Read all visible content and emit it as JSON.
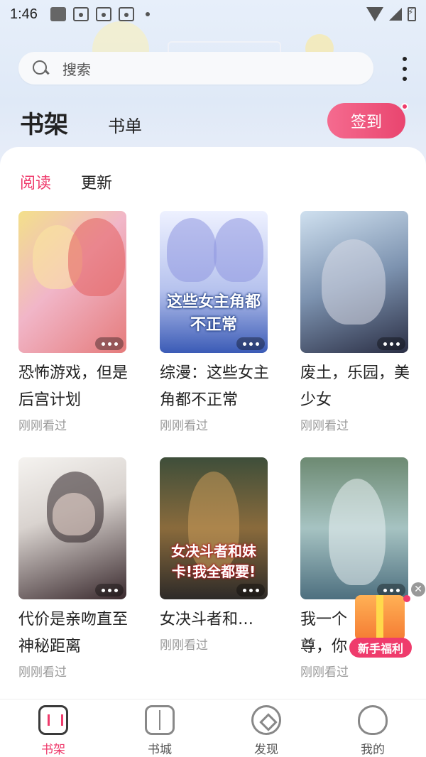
{
  "status_bar": {
    "time": "1:46"
  },
  "search": {
    "placeholder": "搜索"
  },
  "tabs": {
    "bookshelf": "书架",
    "booklist": "书单"
  },
  "checkin": {
    "label": "签到"
  },
  "subtabs": {
    "reading": "阅读",
    "updates": "更新"
  },
  "books": [
    {
      "title": "恐怖游戏，但是后宫计划",
      "status": "刚刚看过"
    },
    {
      "title": "综漫：这些女主角都不正常",
      "status": "刚刚看过",
      "cover_text": "这些女主角都不正常"
    },
    {
      "title": "废土，乐园，美少女",
      "status": "刚刚看过"
    },
    {
      "title": "代价是亲吻直至神秘距离",
      "status": "刚刚看过"
    },
    {
      "title": "女决斗者和妹卡！我全都...",
      "status": "刚刚看过",
      "cover_text": "女决斗者和妹卡!我全都要!"
    },
    {
      "title": "我一个",
      "title_line2": "尊，你",
      "status": "刚刚看过"
    }
  ],
  "gift": {
    "label": "新手福利"
  },
  "bottom_nav": {
    "bookshelf": "书架",
    "bookstore": "书城",
    "discover": "发现",
    "mine": "我的"
  },
  "colors": {
    "accent": "#ef3b6c"
  }
}
